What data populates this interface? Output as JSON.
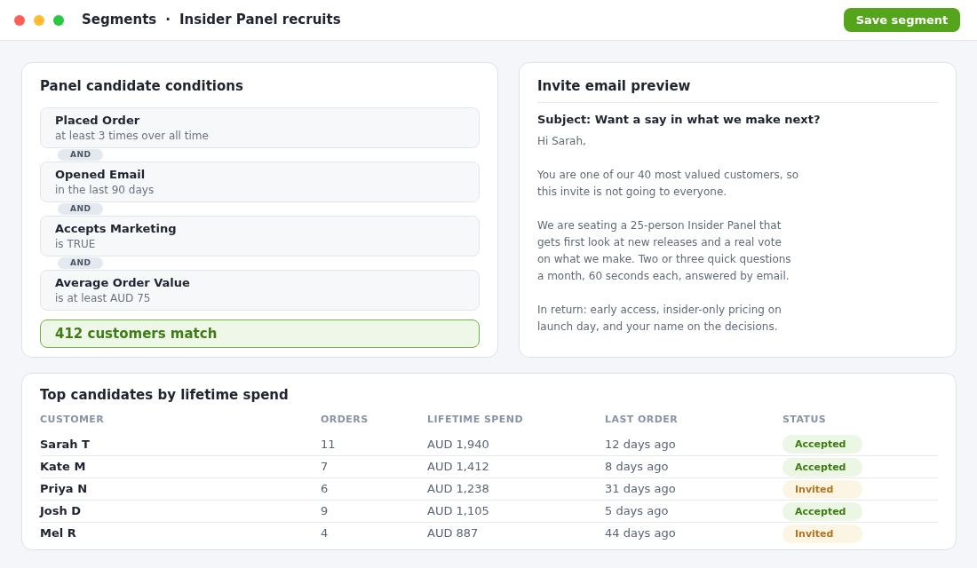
{
  "window": {
    "breadcrumb": [
      "Segments",
      "Insider Panel recruits"
    ],
    "separator": "·",
    "primary_action": "Save segment"
  },
  "conditions_panel": {
    "title": "Panel candidate conditions",
    "conditions": [
      {
        "title": "Placed Order",
        "detail": "at least 3 times over all time"
      },
      {
        "connector": "AND",
        "title": "Opened Email",
        "detail": "in the last 90 days"
      },
      {
        "connector": "AND",
        "title": "Accepts Marketing",
        "detail": "is TRUE"
      },
      {
        "connector": "AND",
        "title": "Average Order Value",
        "detail": "is at least AUD 75"
      }
    ],
    "match_summary": "412 customers match"
  },
  "email_preview": {
    "title": "Invite email preview",
    "subject": "Subject: Want a say in what we make next?",
    "greeting": "Hi Sarah,",
    "paragraphs": [
      "You are one of our 40 most valued customers, so\nthis invite is not going to everyone.",
      "We are seating a 25-person Insider Panel that\ngets first look at new releases and a real vote\non what we make. Two or three quick questions\na month, 60 seconds each, answered by email.",
      "In return: early access, insider-only pricing on\nlaunch day, and your name on the decisions."
    ]
  },
  "table": {
    "title": "Top candidates by lifetime spend",
    "columns": [
      "CUSTOMER",
      "ORDERS",
      "LIFETIME SPEND",
      "LAST ORDER",
      "STATUS"
    ],
    "rows": [
      {
        "customer": "Sarah T",
        "orders": "11",
        "lifetime_spend": "AUD 1,940",
        "last_order": "12 days ago",
        "status": {
          "label": "Accepted",
          "kind": "accepted"
        }
      },
      {
        "customer": "Kate M",
        "orders": "7",
        "lifetime_spend": "AUD 1,412",
        "last_order": "8 days ago",
        "status": {
          "label": "Accepted",
          "kind": "accepted"
        }
      },
      {
        "customer": "Priya N",
        "orders": "6",
        "lifetime_spend": "AUD 1,238",
        "last_order": "31 days ago",
        "status": {
          "label": "Invited",
          "kind": "invited"
        }
      },
      {
        "customer": "Josh D",
        "orders": "9",
        "lifetime_spend": "AUD 1,105",
        "last_order": "5 days ago",
        "status": {
          "label": "Accepted",
          "kind": "accepted"
        }
      },
      {
        "customer": "Mel R",
        "orders": "4",
        "lifetime_spend": "AUD 887",
        "last_order": "44 days ago",
        "status": {
          "label": "Invited",
          "kind": "invited"
        }
      }
    ]
  }
}
